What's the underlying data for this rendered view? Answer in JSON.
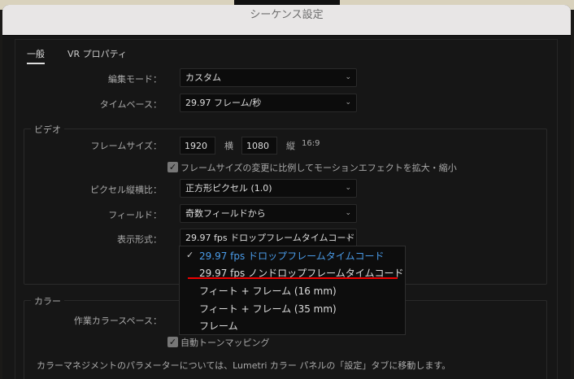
{
  "window": {
    "title": "シーケンス設定"
  },
  "tabs": [
    {
      "label": "一般"
    },
    {
      "label": "VR プロパティ"
    }
  ],
  "general": {
    "edit_mode": {
      "label": "編集モード：",
      "value": "カスタム"
    },
    "timebase": {
      "label": "タイムベース：",
      "value": "29.97  フレーム/秒"
    }
  },
  "video": {
    "group_label": "ビデオ",
    "frame_size": {
      "label": "フレームサイズ：",
      "width": "1920",
      "width_unit": "横",
      "height": "1080",
      "height_unit": "縦",
      "aspect": "16:9"
    },
    "scale_checkbox": {
      "label": "フレームサイズの変更に比例してモーションエフェクトを拡大・縮小",
      "checked": true
    },
    "pixel_aspect": {
      "label": "ピクセル縦横比：",
      "value": "正方形ピクセル (1.0)"
    },
    "fields": {
      "label": "フィールド：",
      "value": "奇数フィールドから"
    },
    "display_format": {
      "label": "表示形式：",
      "value": "29.97 fps ドロップフレームタイムコード"
    }
  },
  "display_menu": {
    "items": [
      {
        "label": "29.97 fps ドロップフレームタイムコード",
        "selected": true
      },
      {
        "label": "29.97 fps ノンドロップフレームタイムコード"
      },
      {
        "label": "フィート + フレーム (16 mm)"
      },
      {
        "label": "フィート + フレーム (35 mm)"
      },
      {
        "label": "フレーム"
      }
    ],
    "check": "✓",
    "highlight_color": "#e00000"
  },
  "color": {
    "group_label": "カラー",
    "working_space": {
      "label": "作業カラースペース："
    },
    "tone_mapping": {
      "label": "自動トーンマッピング",
      "checked": true
    },
    "note": "カラーマネジメントのパラメーターについては、Lumetri カラー パネルの「設定」タブに移動します。"
  }
}
